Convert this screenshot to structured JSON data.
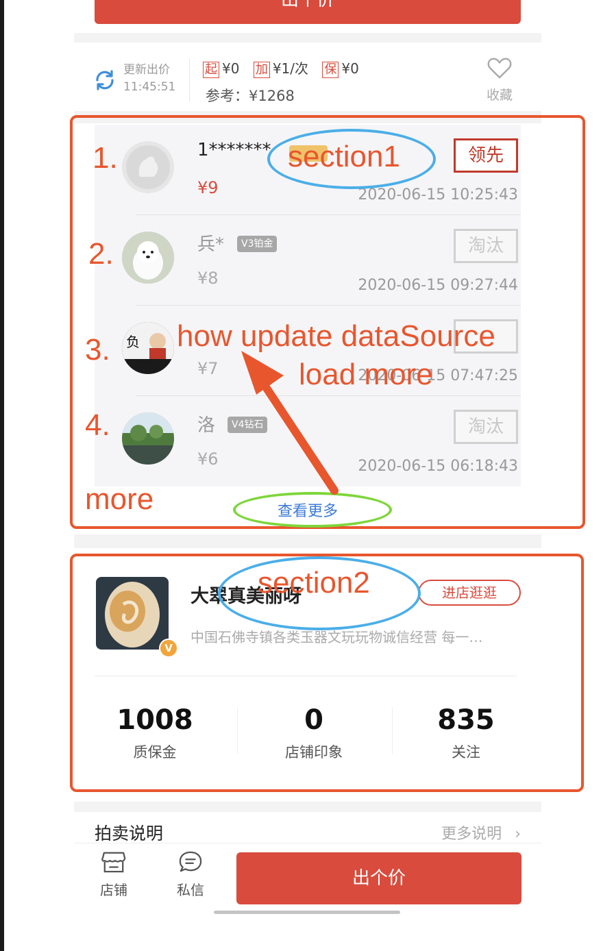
{
  "top_button": {
    "label": "出个价"
  },
  "bid_info": {
    "refresh_label": "更新出价",
    "refresh_time": "11:45:51",
    "rules": [
      {
        "tag": "起",
        "value": "¥0"
      },
      {
        "tag": "加",
        "value": "¥1/次"
      },
      {
        "tag": "保",
        "value": "¥0"
      }
    ],
    "reference": "参考：¥1268",
    "favorite_label": "收藏"
  },
  "bids": [
    {
      "name": "1*******",
      "vip": "",
      "price": "¥9",
      "status": "领先",
      "time": "2020-06-15 10:25:43"
    },
    {
      "name": "兵*",
      "vip": "V3铂金",
      "price": "¥8",
      "status": "淘汰",
      "time": "2020-06-15 09:27:44"
    },
    {
      "name": "",
      "vip": "",
      "price": "¥7",
      "status": "",
      "time": "2020-06-15 07:47:25"
    },
    {
      "name": "洛",
      "vip": "V4钻石",
      "price": "¥6",
      "status": "淘汰",
      "time": "2020-06-15 06:18:43"
    }
  ],
  "see_more": "查看更多",
  "shop": {
    "name": "大翠真美丽呀",
    "description": "中国石佛寺镇各类玉器文玩玩物诚信经营 每一…",
    "enter_label": "进店逛逛",
    "badge": "V",
    "stats": [
      {
        "value": "1008",
        "label": "质保金"
      },
      {
        "value": "0",
        "label": "店铺印象"
      },
      {
        "value": "835",
        "label": "关注"
      }
    ]
  },
  "auction_notes": {
    "title": "拍卖说明",
    "more": "更多说明"
  },
  "tabbar": {
    "shop_label": "店铺",
    "message_label": "私信",
    "bid_label": "出个价"
  },
  "annotations": {
    "section1": "section1",
    "section2": "section2",
    "numbers": [
      "1.",
      "2.",
      "3.",
      "4."
    ],
    "question_line1": "how update dataSource",
    "question_line2": "load more",
    "more": "more"
  },
  "colors": {
    "primary_red": "#d94b3d",
    "annotation_orange": "#e8562e",
    "annotation_blue": "#4aaee8",
    "annotation_green": "#7ed63a",
    "link_blue": "#3d7bd6"
  }
}
